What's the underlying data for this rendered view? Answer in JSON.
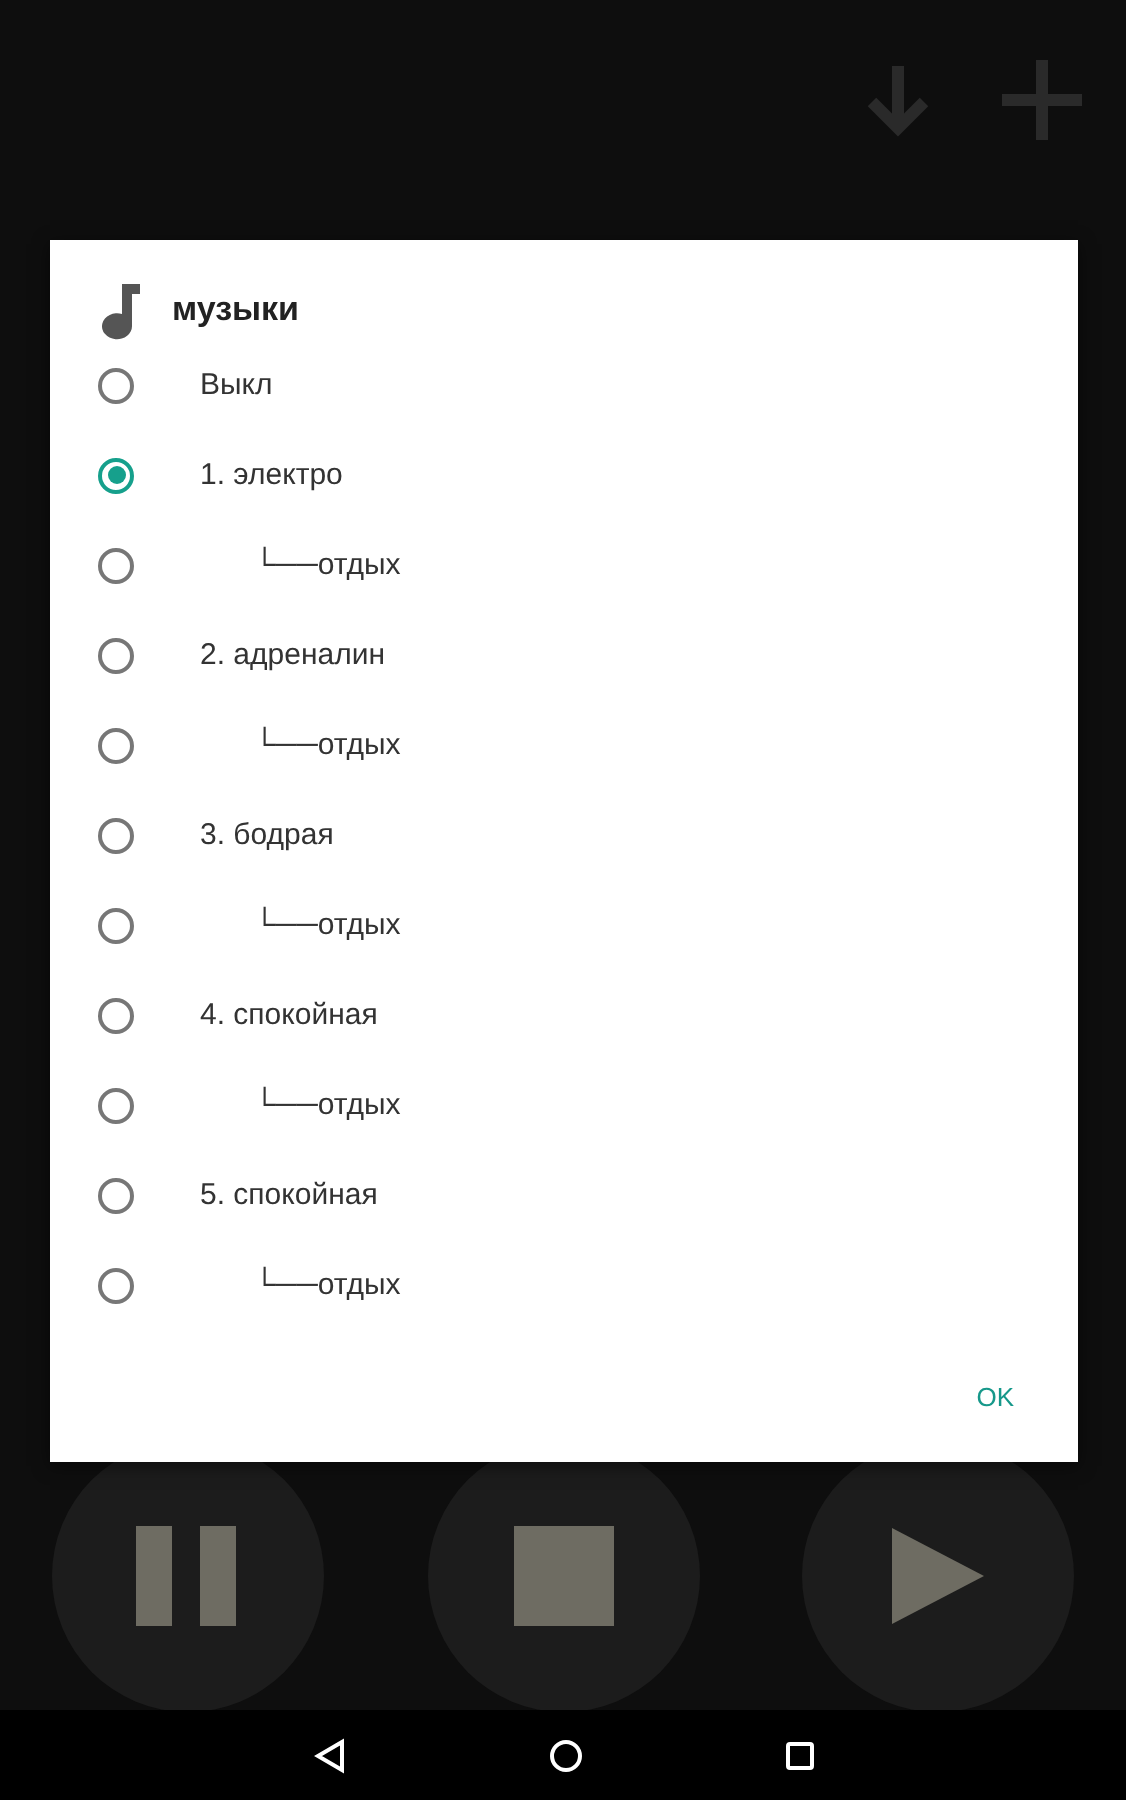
{
  "dialog": {
    "title": "музыки",
    "options": [
      {
        "label": "Выкл",
        "kind": "main",
        "selected": false
      },
      {
        "label": "1. электро",
        "kind": "main",
        "selected": true
      },
      {
        "label": "└──отдых",
        "kind": "sub",
        "selected": false
      },
      {
        "label": "2. адреналин",
        "kind": "main",
        "selected": false
      },
      {
        "label": "└──отдых",
        "kind": "sub",
        "selected": false
      },
      {
        "label": "3. бодрая",
        "kind": "main",
        "selected": false
      },
      {
        "label": "└──отдых",
        "kind": "sub",
        "selected": false
      },
      {
        "label": "4. спокойная",
        "kind": "main",
        "selected": false
      },
      {
        "label": "└──отдых",
        "kind": "sub",
        "selected": false
      },
      {
        "label": "5. спокойная",
        "kind": "main",
        "selected": false
      },
      {
        "label": "└──отдых",
        "kind": "sub",
        "selected": false
      }
    ],
    "buttons": [
      "OK"
    ]
  }
}
